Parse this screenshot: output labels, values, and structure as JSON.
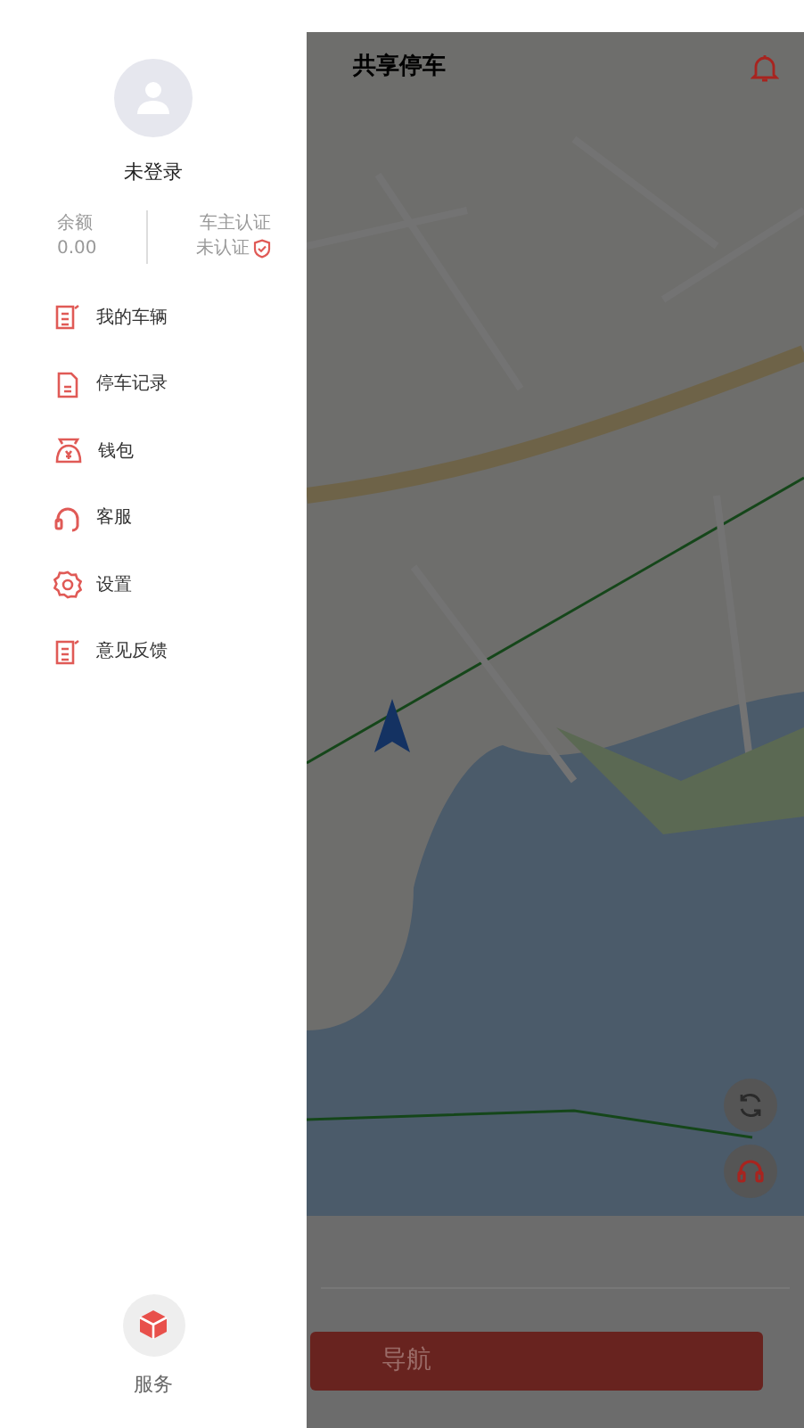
{
  "drawer": {
    "user": {
      "name": "未登录"
    },
    "balance": {
      "label": "余额",
      "value": "0.00"
    },
    "verification": {
      "label": "车主认证",
      "status": "未认证"
    },
    "menu": [
      {
        "label": "我的车辆",
        "kind": "note"
      },
      {
        "label": "停车记录",
        "kind": "doc"
      },
      {
        "label": "钱包",
        "kind": "wallet"
      },
      {
        "label": "客服",
        "kind": "headset"
      },
      {
        "label": "设置",
        "kind": "gear"
      },
      {
        "label": "意见反馈",
        "kind": "note"
      }
    ],
    "service": {
      "label": "服务"
    }
  },
  "app": {
    "title": "共享停车",
    "nav_button": "导航"
  }
}
